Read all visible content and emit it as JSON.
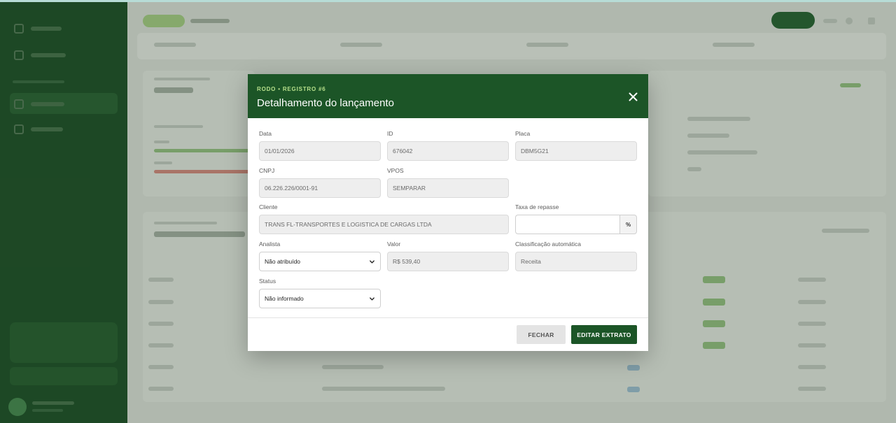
{
  "modal": {
    "eyebrow": "RODO • REGISTRO #6",
    "title": "Detalhamento do lançamento",
    "fields": {
      "data": {
        "label": "Data",
        "value": "01/01/2026"
      },
      "id": {
        "label": "ID",
        "value": "676042"
      },
      "placa": {
        "label": "Placa",
        "value": "DBM5G21"
      },
      "cnpj": {
        "label": "CNPJ",
        "value": "06.226.226/0001-91"
      },
      "vpos": {
        "label": "VPOS",
        "value": "SEMPARAR"
      },
      "cliente": {
        "label": "Cliente",
        "value": "TRANS FL-TRANSPORTES E LOGISTICA DE CARGAS LTDA"
      },
      "taxa": {
        "label": "Taxa de repasse",
        "value": "",
        "suffix": "%"
      },
      "analista": {
        "label": "Analista",
        "value": "Não atribuído"
      },
      "valor": {
        "label": "Valor",
        "value": "R$ 539,40"
      },
      "classificacao": {
        "label": "Classificação automática",
        "value": "Receita"
      },
      "status": {
        "label": "Status",
        "value": "Não informado"
      }
    },
    "buttons": {
      "close": "FECHAR",
      "edit": "EDITAR EXTRATO"
    }
  },
  "colors": {
    "header_green": "#1c5527",
    "eyebrow_lime": "#b7e08b",
    "sidebar_green": "#1d4a25"
  }
}
